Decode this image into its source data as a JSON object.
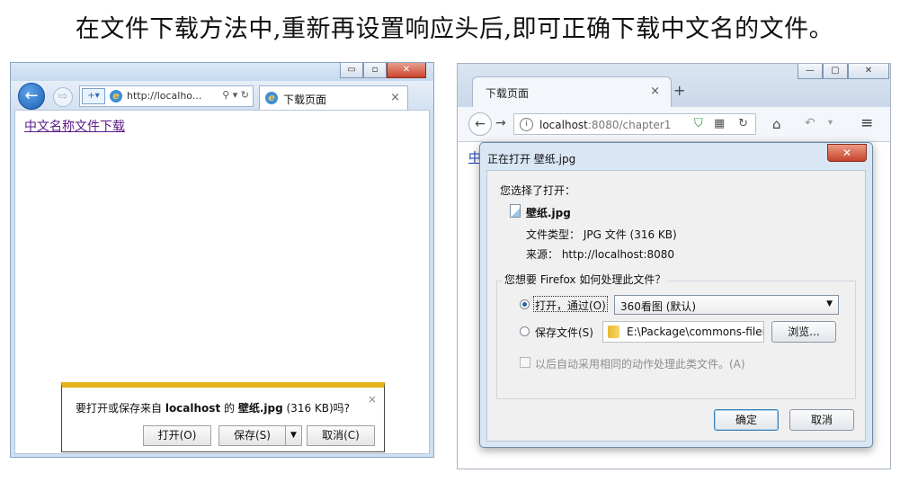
{
  "heading": "在文件下载方法中,重新再设置响应头后,即可正确下载中文名的文件。",
  "ie": {
    "window_buttons": {
      "minimize": "▭",
      "maximize": "▫",
      "close": "✕"
    },
    "back_icon": "←",
    "forward_icon": "⇨",
    "url": "http://localho...",
    "addr_tools": "⚲ ▾ ↻",
    "tab_title": "下载页面",
    "tab_close": "×",
    "page_link": "中文名称文件下载",
    "notification": {
      "prefix": "要打开或保存来自 ",
      "host": "localhost",
      "middle": " 的 ",
      "file": "壁纸.jpg",
      "suffix": " (316 KB)吗?",
      "close": "×",
      "open_label": "打开(O)",
      "save_label": "保存(S)",
      "save_arrow": "▼",
      "cancel_label": "取消(C)"
    }
  },
  "firefox": {
    "window_buttons": {
      "minimize": "—",
      "maximize": "▢",
      "close": "✕"
    },
    "tab_title": "下载页面",
    "tab_close": "×",
    "new_tab": "+",
    "back_icon": "←",
    "forward_icon": "→",
    "info_icon": "i",
    "url_host": "localhost",
    "url_rest": ":8080/chapter1",
    "page_link_partial": "中",
    "dialog": {
      "title": "正在打开 壁纸.jpg",
      "close": "✕",
      "you_chose": "您选择了打开：",
      "file_name": "壁纸.jpg",
      "file_type": "文件类型： JPG 文件 (316 KB)",
      "source": "来源： http://localhost:8080",
      "question": "您想要 Firefox 如何处理此文件？",
      "open_with_label": "打开，通过(O)",
      "open_with_value": "360看图 (默认)",
      "dropdown_arrow": "▼",
      "save_file_label": "保存文件(S)",
      "save_path": "E:\\Package\\commons-filei",
      "browse_label": "浏览...",
      "auto_label": "以后自动采用相同的动作处理此类文件。(A)",
      "ok_label": "确定",
      "cancel_label": "取消"
    }
  }
}
